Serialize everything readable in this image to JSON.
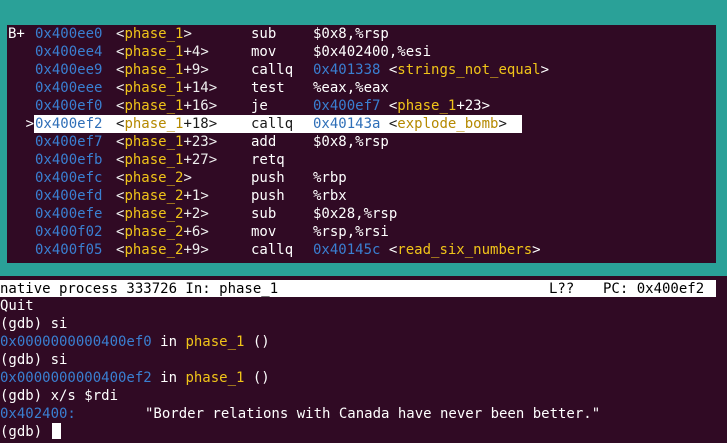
{
  "asm": [
    {
      "prefix": "B+",
      "addr": "0x400ee0",
      "fn": "phase_1",
      "off": "",
      "op": "sub",
      "args": "$0x8,%rsp",
      "taddr": "",
      "tfn": "",
      "toff": ""
    },
    {
      "prefix": "",
      "addr": "0x400ee4",
      "fn": "phase_1",
      "off": "+4",
      "op": "mov",
      "args": "$0x402400,%esi",
      "taddr": "",
      "tfn": "",
      "toff": ""
    },
    {
      "prefix": "",
      "addr": "0x400ee9",
      "fn": "phase_1",
      "off": "+9",
      "op": "callq",
      "args": "",
      "taddr": "0x401338",
      "tfn": "strings_not_equal",
      "toff": ""
    },
    {
      "prefix": "",
      "addr": "0x400eee",
      "fn": "phase_1",
      "off": "+14",
      "op": "test",
      "args": "%eax,%eax",
      "taddr": "",
      "tfn": "",
      "toff": ""
    },
    {
      "prefix": "",
      "addr": "0x400ef0",
      "fn": "phase_1",
      "off": "+16",
      "op": "je",
      "args": "",
      "taddr": "0x400ef7",
      "tfn": "phase_1",
      "toff": "+23"
    },
    {
      "prefix": ">",
      "addr": "0x400ef2",
      "fn": "phase_1",
      "off": "+18",
      "op": "callq",
      "args": "",
      "taddr": "0x40143a",
      "tfn": "explode_bomb",
      "toff": "",
      "current": true
    },
    {
      "prefix": "",
      "addr": "0x400ef7",
      "fn": "phase_1",
      "off": "+23",
      "op": "add",
      "args": "$0x8,%rsp",
      "taddr": "",
      "tfn": "",
      "toff": ""
    },
    {
      "prefix": "",
      "addr": "0x400efb",
      "fn": "phase_1",
      "off": "+27",
      "op": "retq",
      "args": "",
      "taddr": "",
      "tfn": "",
      "toff": ""
    },
    {
      "prefix": "",
      "addr": "0x400efc",
      "fn": "phase_2",
      "off": "",
      "op": "push",
      "args": "%rbp",
      "taddr": "",
      "tfn": "",
      "toff": ""
    },
    {
      "prefix": "",
      "addr": "0x400efd",
      "fn": "phase_2",
      "off": "+1",
      "op": "push",
      "args": "%rbx",
      "taddr": "",
      "tfn": "",
      "toff": ""
    },
    {
      "prefix": "",
      "addr": "0x400efe",
      "fn": "phase_2",
      "off": "+2",
      "op": "sub",
      "args": "$0x28,%rsp",
      "taddr": "",
      "tfn": "",
      "toff": ""
    },
    {
      "prefix": "",
      "addr": "0x400f02",
      "fn": "phase_2",
      "off": "+6",
      "op": "mov",
      "args": "%rsp,%rsi",
      "taddr": "",
      "tfn": "",
      "toff": ""
    },
    {
      "prefix": "",
      "addr": "0x400f05",
      "fn": "phase_2",
      "off": "+9",
      "op": "callq",
      "args": "",
      "taddr": "0x40145c",
      "tfn": "read_six_numbers",
      "toff": ""
    }
  ],
  "status": {
    "process": "native process 333726 In: phase_1",
    "line": "L??",
    "pc": "PC: 0x400ef2"
  },
  "console": {
    "l1": "Quit",
    "l2": "(gdb) si",
    "l3_addr": "0x0000000000400ef0",
    "l3_in": " in ",
    "l3_fn": "phase_1",
    "l3_tail": " ()",
    "l4": "(gdb) si",
    "l5_addr": "0x0000000000400ef2",
    "l5_in": " in ",
    "l5_fn": "phase_1",
    "l5_tail": " ()",
    "l6": "(gdb) x/s $rdi",
    "l7_addr": "0x402400:",
    "l7_str": "\"Border relations with Canada have never been better.\"",
    "prompt": "(gdb) "
  },
  "colors": {
    "background": "#300a24",
    "frame": "#2aa198",
    "address": "#3a7fd1",
    "symbol": "#f0c419"
  }
}
